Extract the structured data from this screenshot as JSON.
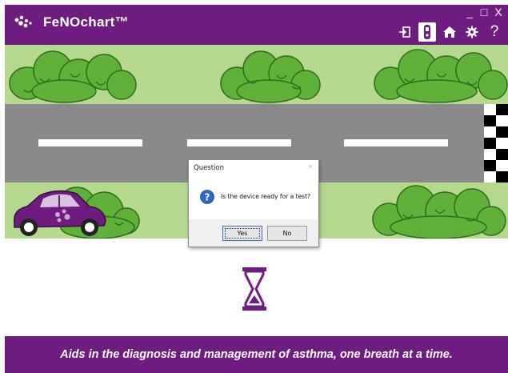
{
  "app": {
    "title": "FeNOchart™",
    "brand_color": "#6f1c80",
    "window_controls": [
      "_",
      "□",
      "X"
    ]
  },
  "toolbar": {
    "icons": [
      "sign-in-icon",
      "device-icon",
      "home-icon",
      "gear-icon",
      "help-icon"
    ],
    "help_label": "?"
  },
  "dialog": {
    "title": "Question",
    "close": "×",
    "message": "Is the device ready for a test?",
    "yes_label": "Yes",
    "no_label": "No",
    "icon": "question-icon"
  },
  "footer": {
    "tagline": "Aids in the diagnosis and management of asthma, one breath at a time."
  }
}
